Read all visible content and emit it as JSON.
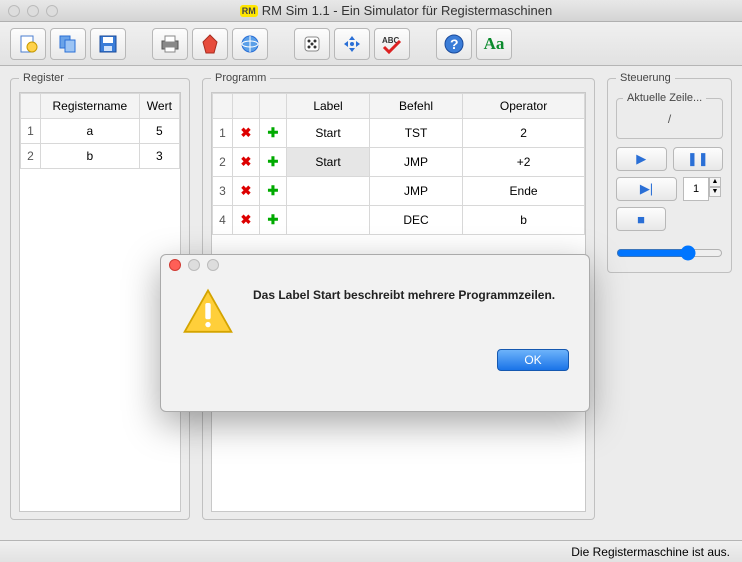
{
  "window": {
    "title": "RM Sim 1.1 - Ein Simulator für Registermaschinen"
  },
  "panels": {
    "register_title": "Register",
    "program_title": "Programm",
    "control_title": "Steuerung",
    "current_line_title": "Aktuelle Zeile...",
    "slash": "/"
  },
  "register_table": {
    "headers": {
      "name": "Registername",
      "value": "Wert"
    },
    "rows": [
      {
        "n": "1",
        "name": "a",
        "value": "5"
      },
      {
        "n": "2",
        "name": "b",
        "value": "3"
      }
    ]
  },
  "program_table": {
    "headers": {
      "label": "Label",
      "cmd": "Befehl",
      "op": "Operator"
    },
    "rows": [
      {
        "n": "1",
        "label": "Start",
        "cmd": "TST",
        "op": "2",
        "sel": false
      },
      {
        "n": "2",
        "label": "Start",
        "cmd": "JMP",
        "op": "+2",
        "sel": true
      },
      {
        "n": "3",
        "label": "",
        "cmd": "JMP",
        "op": "Ende",
        "sel": false
      },
      {
        "n": "4",
        "label": "",
        "cmd": "DEC",
        "op": "b",
        "sel": false
      }
    ]
  },
  "control": {
    "step_value": "1"
  },
  "dialog": {
    "message": "Das Label Start beschreibt mehrere Programmzeilen.",
    "ok": "OK"
  },
  "status": "Die Registermaschine ist aus.",
  "icons": {
    "new": "new-document-icon",
    "copy": "copy-icon",
    "save": "save-icon",
    "print": "print-icon",
    "pdf": "pdf-icon",
    "web": "web-icon",
    "dice": "dice-icon",
    "move": "move-icon",
    "spell": "spellcheck-icon",
    "help": "help-icon",
    "font": "font-icon"
  },
  "aa_text": "Aa"
}
